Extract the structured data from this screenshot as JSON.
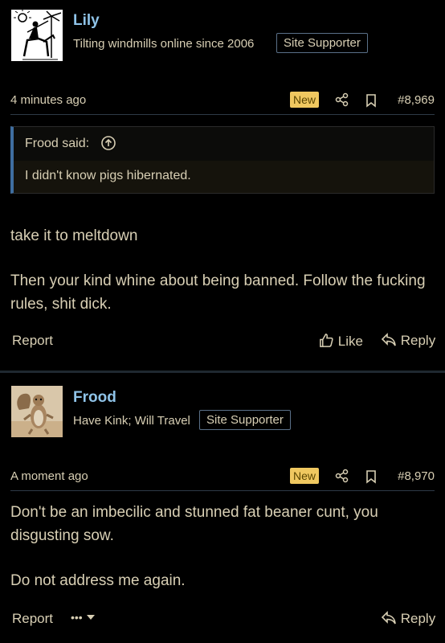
{
  "colors": {
    "background": "#000000",
    "text": "#d8cfb4",
    "username": "#8fc3e8",
    "new_badge": "#f0c860",
    "quote_border": "#3f6ea0"
  },
  "posts": [
    {
      "username": "Lily",
      "user_title": "Tilting windmills online since 2006",
      "badge": "Site Supporter",
      "timestamp": "4 minutes ago",
      "new_label": "New",
      "post_number": "#8,969",
      "quote": {
        "author_label": "Frood said:",
        "text": "I didn't know pigs hibernated."
      },
      "paragraphs": [
        "take it to meltdown",
        "Then your kind whine about being banned. Follow the fucking rules, shit dick."
      ],
      "actions": {
        "report": "Report",
        "like": "Like",
        "reply": "Reply"
      },
      "icons": [
        "share-icon",
        "bookmark-icon",
        "arrow-up-circle-icon",
        "thumbs-up-icon",
        "reply-icon"
      ]
    },
    {
      "username": "Frood",
      "user_title": "Have Kink; Will Travel",
      "badge": "Site Supporter",
      "timestamp": "A moment ago",
      "new_label": "New",
      "post_number": "#8,970",
      "paragraphs": [
        "Don't be an imbecilic and stunned fat beaner cunt, you disgusting sow.",
        "Do not address me again."
      ],
      "actions": {
        "report": "Report",
        "more": "•••",
        "reply": "Reply"
      },
      "icons": [
        "share-icon",
        "bookmark-icon",
        "more-dots-icon",
        "caret-down-icon",
        "reply-icon"
      ]
    }
  ]
}
